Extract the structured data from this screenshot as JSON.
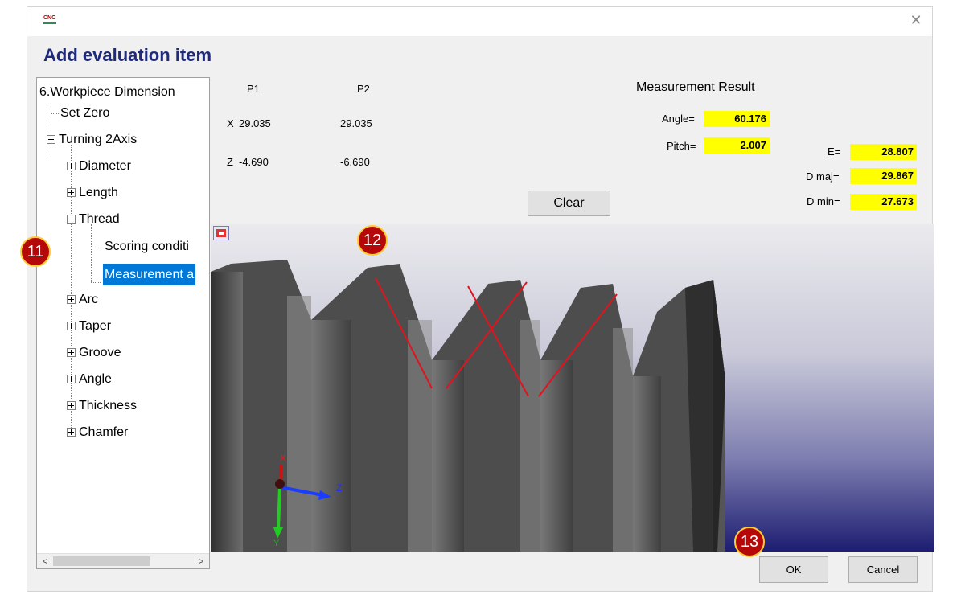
{
  "window": {
    "app_icon_text": "CNC",
    "close_symbol": "✕"
  },
  "dialog_title": "Add evaluation item",
  "tree": {
    "root": "6.Workpiece Dimension",
    "items": [
      {
        "label": "Set Zero"
      },
      {
        "label": "Turning 2Axis"
      },
      {
        "label": "Diameter"
      },
      {
        "label": "Length"
      },
      {
        "label": "Thread"
      },
      {
        "label": "Scoring conditi"
      },
      {
        "label": "Measurement a"
      },
      {
        "label": "Arc"
      },
      {
        "label": "Taper"
      },
      {
        "label": "Groove"
      },
      {
        "label": "Angle"
      },
      {
        "label": "Thickness"
      },
      {
        "label": "Chamfer"
      }
    ],
    "scroll_left": "<",
    "scroll_right": ">"
  },
  "points": {
    "col_p1": "P1",
    "col_p2": "P2",
    "x_label": "X",
    "x_p1": "29.035",
    "x_p2": "29.035",
    "z_label": "Z",
    "z_p1": "-4.690",
    "z_p2": "-6.690"
  },
  "result": {
    "title": "Measurement Result",
    "angle_label": "Angle=",
    "angle_value": "60.176",
    "pitch_label": "Pitch=",
    "pitch_value": "2.007",
    "e_label": "E=",
    "e_value": "28.807",
    "dmaj_label": "D maj=",
    "dmaj_value": "29.867",
    "dmin_label": "D min=",
    "dmin_value": "27.673"
  },
  "buttons": {
    "clear": "Clear",
    "ok": "OK",
    "cancel": "Cancel"
  },
  "badges": {
    "tree": "11",
    "viewport": "12",
    "ok": "13"
  },
  "axes": {
    "x": "X",
    "y": "Y",
    "z": "Z"
  },
  "colors": {
    "highlight": "#ffff00",
    "selection": "#0078d7",
    "measure_line": "#e0141e",
    "badge": "#b50808",
    "title": "#1f2a7a"
  }
}
